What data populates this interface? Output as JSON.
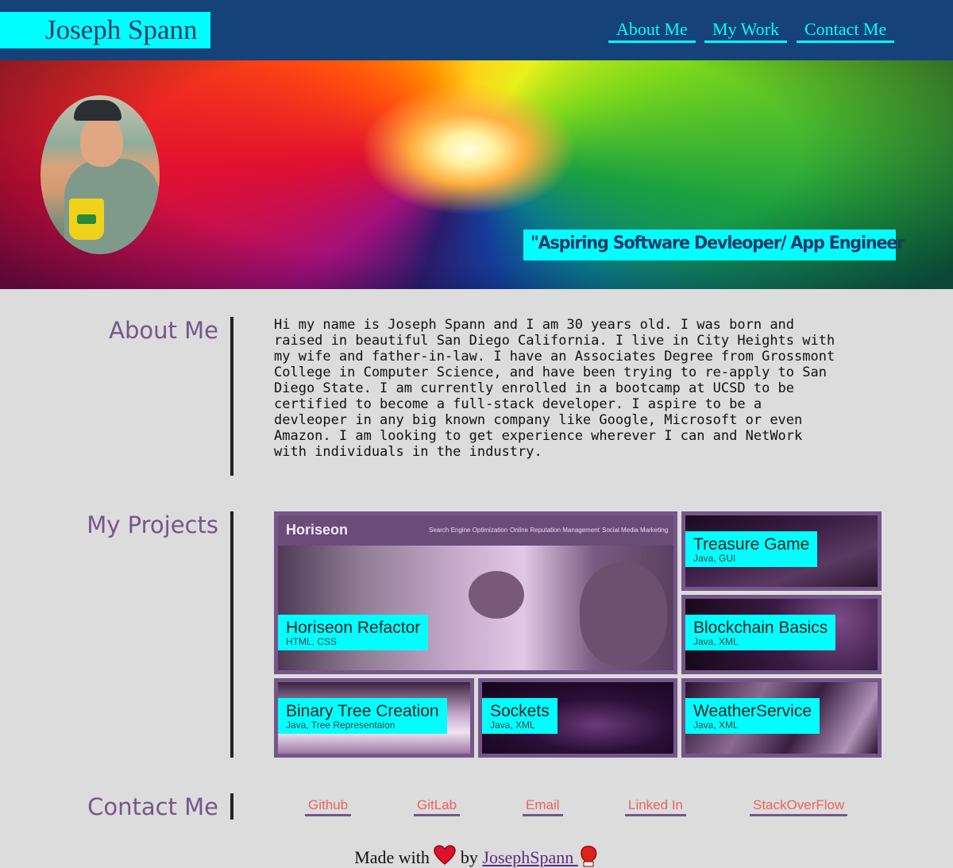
{
  "header": {
    "brand": "Joseph Spann",
    "nav": [
      "About Me",
      "My Work",
      "Contact Me"
    ]
  },
  "hero": {
    "tagline": "\"Aspiring Software Devleoper/ App Engineer"
  },
  "about": {
    "title": "About Me",
    "text": "Hi my name is Joseph Spann and I am 30 years old. I was born and\nraised in beautiful San Diego California. I live in City Heights with\nmy wife and father-in-law. I have an Associates Degree from Grossmont\nCollege in Computer Science, and have been trying to re-apply to San\nDiego State. I am currently enrolled in a bootcamp at UCSD to be\ncertified to become a full-stack developer. I aspire to be a\ndevleoper in any big known company like Google, Microsoft or even\nAmazon. I am looking to get experience wherever I can and NetWork\nwith individuals in the industry."
  },
  "projects": {
    "title": "My Projects",
    "horiseon_header": {
      "logo": "Horiseon",
      "links": [
        "Search Engine Optimization",
        "Online Reputation Management",
        "Social Media Marketing"
      ]
    },
    "items": [
      {
        "title": "Horiseon Refactor",
        "tech": "HTML, CSS"
      },
      {
        "title": "Treasure Game",
        "tech": "Java, GUI"
      },
      {
        "title": "Blockchain Basics",
        "tech": "Java, XML"
      },
      {
        "title": "Binary Tree Creation",
        "tech": "Java, Tree Representaion"
      },
      {
        "title": "Sockets",
        "tech": "Java, XML"
      },
      {
        "title": "WeatherService",
        "tech": "Java, XML"
      }
    ]
  },
  "contact": {
    "title": "Contact Me",
    "links": [
      "Github",
      "GitLab",
      "Email",
      "Linked In",
      "StackOverFlow"
    ]
  },
  "footer": {
    "made_with": "Made with",
    "by": "by",
    "author": "JosephSpann",
    "heart_icon": "heart-icon",
    "glove_icon": "boxing-glove-icon"
  },
  "colors": {
    "header_bg": "#16427a",
    "accent": "#00ffff",
    "section_title": "#76568a",
    "contact_link": "#ef6161",
    "page_bg": "#dcdcdc"
  }
}
